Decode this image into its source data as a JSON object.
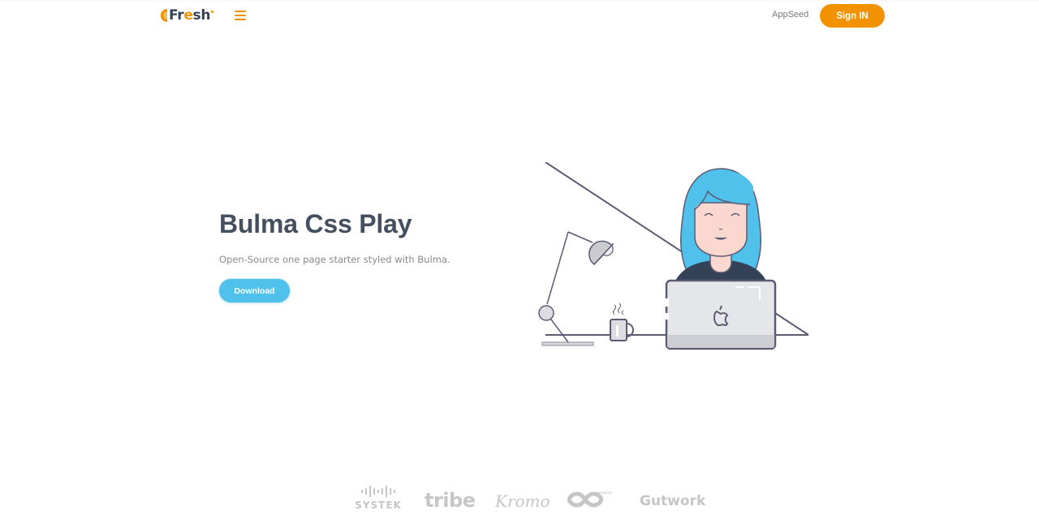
{
  "navbar": {
    "brand": {
      "prefix": "Fr",
      "accent": "e",
      "suffix": "sh"
    },
    "menu_icon": "hamburger-menu-icon",
    "links": [
      {
        "label": "AppSeed"
      }
    ],
    "signin_label": "Sign IN"
  },
  "hero": {
    "title": "Bulma Css Play",
    "subtitle": "Open-Source one page starter styled with Bulma.",
    "download_label": "Download",
    "illustration": "woman-at-desk-with-laptop-lamp-and-mug"
  },
  "clients": {
    "logos": [
      {
        "name": "SYSTEK"
      },
      {
        "name": "tribe"
      },
      {
        "name": "Kromo"
      },
      {
        "name": "INFINITE"
      },
      {
        "name": "Gutwork"
      }
    ]
  },
  "colors": {
    "primary": "#F39200",
    "accent_blue": "#4FC1EA",
    "heading": "#444F60",
    "logo_gray": "#C6C6C6"
  }
}
